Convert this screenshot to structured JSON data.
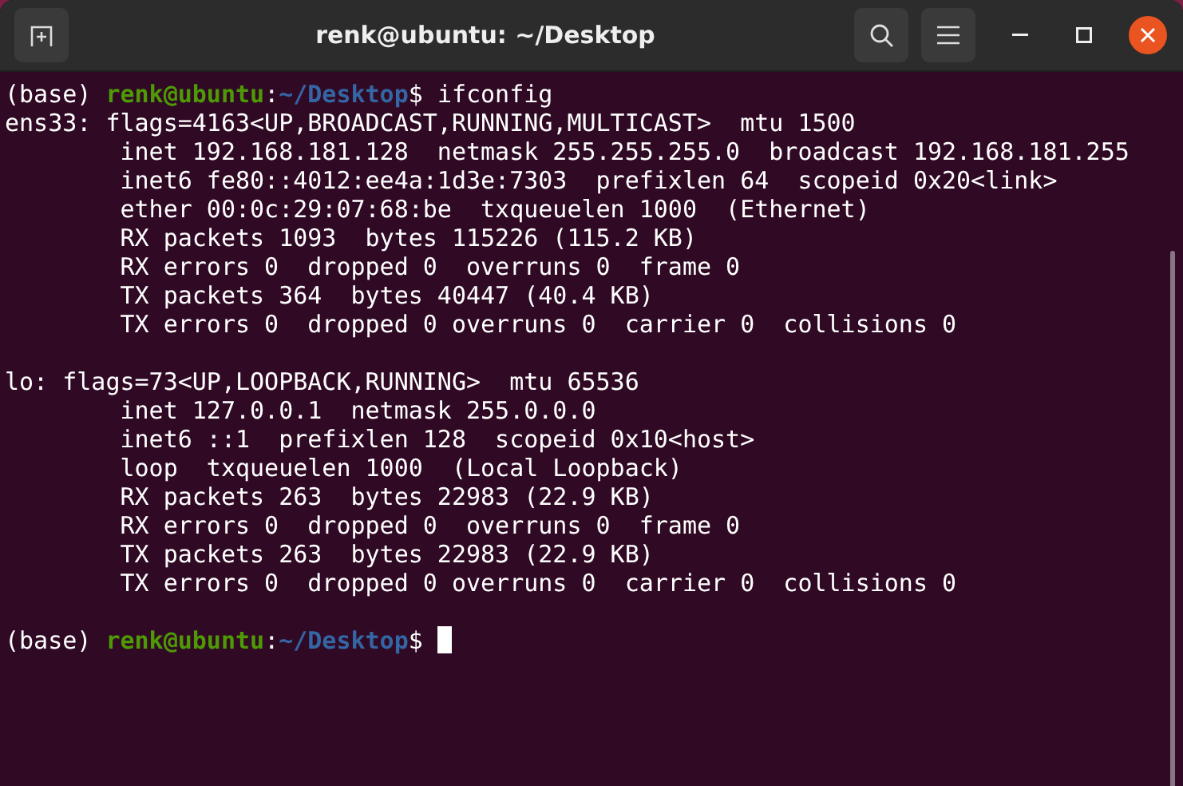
{
  "window": {
    "title": "renk@ubuntu: ~/Desktop"
  },
  "terminal": {
    "lines": [
      {
        "kind": "prompt",
        "env": "(base)",
        "user_host": "renk@ubuntu",
        "separator": ":",
        "path": "~/Desktop",
        "sigil": "$",
        "command": "ifconfig",
        "cursor": false
      },
      {
        "kind": "output",
        "text": "ens33: flags=4163<UP,BROADCAST,RUNNING,MULTICAST>  mtu 1500"
      },
      {
        "kind": "output",
        "text": "        inet 192.168.181.128  netmask 255.255.255.0  broadcast 192.168.181.255"
      },
      {
        "kind": "output",
        "text": "        inet6 fe80::4012:ee4a:1d3e:7303  prefixlen 64  scopeid 0x20<link>"
      },
      {
        "kind": "output",
        "text": "        ether 00:0c:29:07:68:be  txqueuelen 1000  (Ethernet)"
      },
      {
        "kind": "output",
        "text": "        RX packets 1093  bytes 115226 (115.2 KB)"
      },
      {
        "kind": "output",
        "text": "        RX errors 0  dropped 0  overruns 0  frame 0"
      },
      {
        "kind": "output",
        "text": "        TX packets 364  bytes 40447 (40.4 KB)"
      },
      {
        "kind": "output",
        "text": "        TX errors 0  dropped 0 overruns 0  carrier 0  collisions 0"
      },
      {
        "kind": "blank"
      },
      {
        "kind": "output",
        "text": "lo: flags=73<UP,LOOPBACK,RUNNING>  mtu 65536"
      },
      {
        "kind": "output",
        "text": "        inet 127.0.0.1  netmask 255.0.0.0"
      },
      {
        "kind": "output",
        "text": "        inet6 ::1  prefixlen 128  scopeid 0x10<host>"
      },
      {
        "kind": "output",
        "text": "        loop  txqueuelen 1000  (Local Loopback)"
      },
      {
        "kind": "output",
        "text": "        RX packets 263  bytes 22983 (22.9 KB)"
      },
      {
        "kind": "output",
        "text": "        RX errors 0  dropped 0  overruns 0  frame 0"
      },
      {
        "kind": "output",
        "text": "        TX packets 263  bytes 22983 (22.9 KB)"
      },
      {
        "kind": "output",
        "text": "        TX errors 0  dropped 0 overruns 0  carrier 0  collisions 0"
      },
      {
        "kind": "blank"
      },
      {
        "kind": "prompt",
        "env": "(base)",
        "user_host": "renk@ubuntu",
        "separator": ":",
        "path": "~/Desktop",
        "sigil": "$",
        "cursor": true
      }
    ]
  }
}
